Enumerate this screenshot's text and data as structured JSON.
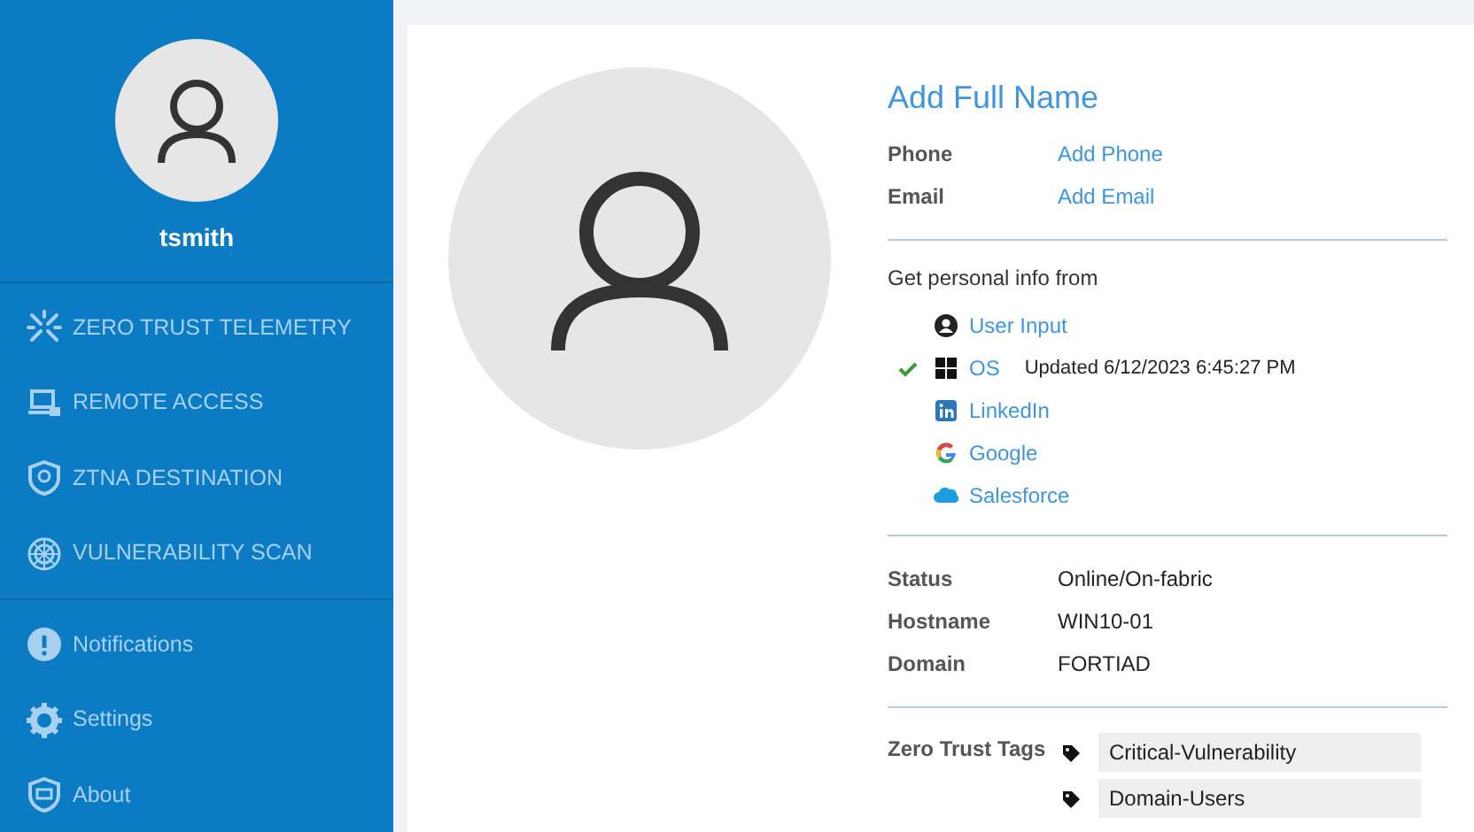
{
  "user": {
    "username": "tsmith"
  },
  "nav_groups": [
    [
      {
        "kind": "telemetry",
        "label": "ZERO TRUST TELEMETRY"
      },
      {
        "kind": "remote",
        "label": "REMOTE ACCESS"
      },
      {
        "kind": "ztna",
        "label": "ZTNA DESTINATION"
      },
      {
        "kind": "scan",
        "label": "VULNERABILITY SCAN"
      }
    ],
    [
      {
        "kind": "notifications",
        "label": "Notifications"
      },
      {
        "kind": "settings",
        "label": "Settings"
      },
      {
        "kind": "about",
        "label": "About"
      }
    ]
  ],
  "profile": {
    "full_name": "Add Full Name",
    "contact": [
      {
        "label": "Phone",
        "value": "Add Phone"
      },
      {
        "label": "Email",
        "value": "Add Email"
      }
    ],
    "sources_heading": "Get personal info from",
    "sources": [
      {
        "kind": "user",
        "label": "User Input",
        "checked": false
      },
      {
        "kind": "windows",
        "label": "OS",
        "checked": true,
        "note": "Updated 6/12/2023 6:45:27 PM"
      },
      {
        "kind": "linkedin",
        "label": "LinkedIn",
        "checked": false
      },
      {
        "kind": "google",
        "label": "Google",
        "checked": false
      },
      {
        "kind": "salesforce",
        "label": "Salesforce",
        "checked": false
      }
    ],
    "details": [
      {
        "label": "Status",
        "value": "Online/On-fabric"
      },
      {
        "label": "Hostname",
        "value": "WIN10-01"
      },
      {
        "label": "Domain",
        "value": "FORTIAD"
      }
    ],
    "tags_label": "Zero Trust Tags",
    "tags": [
      "Critical-Vulnerability",
      "Domain-Users"
    ]
  }
}
